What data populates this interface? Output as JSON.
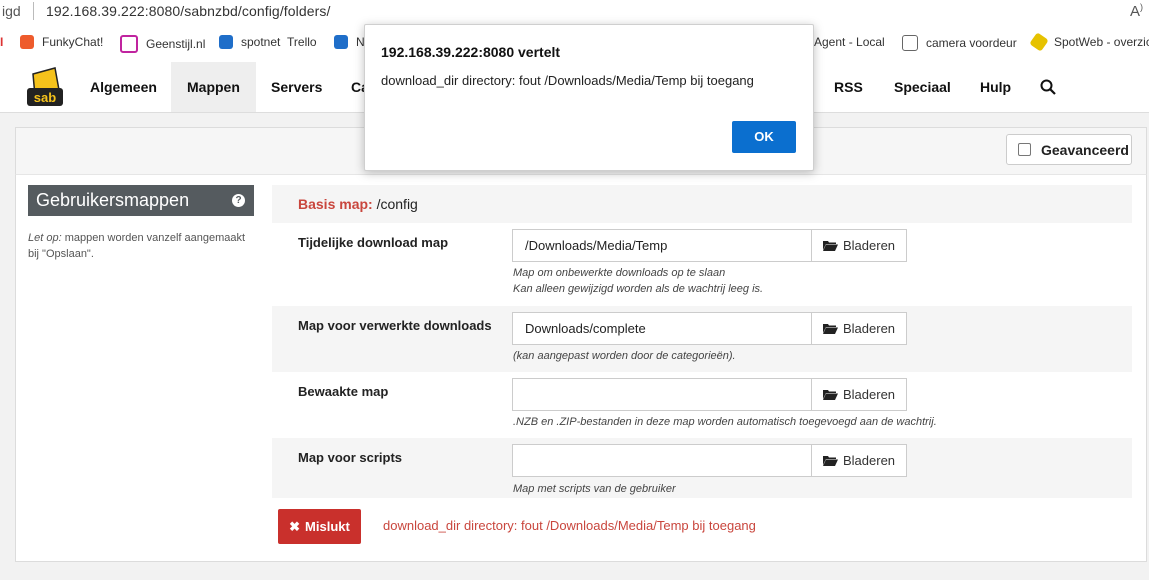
{
  "browser": {
    "left_fragment": "igd",
    "url": "192.168.39.222:8080/sabnzbd/config/folders/",
    "reader_icon": "reader-mode-icon"
  },
  "bookmarks": [
    {
      "label": "FunkyChat!",
      "icon": "funkychat-icon"
    },
    {
      "label": "Geenstijl.nl",
      "icon": "geenstijl-icon"
    },
    {
      "label": "spotnet",
      "icon": "trello-icon"
    },
    {
      "label": "Trello",
      "icon": "trello-icon"
    },
    {
      "label": "N",
      "icon": "q-icon"
    },
    {
      "label": "Agent - Local",
      "icon": ""
    },
    {
      "label": "camera voordeur",
      "icon": "document-icon"
    },
    {
      "label": "SpotWeb - overzic",
      "icon": "spotweb-icon"
    }
  ],
  "nav": {
    "items": [
      "Algemeen",
      "Mappen",
      "Servers",
      "Ca",
      "RSS",
      "Speciaal",
      "Hulp"
    ],
    "active": "Mappen"
  },
  "advanced": {
    "label": "Geavanceerd",
    "checked": false
  },
  "sidebar": {
    "title": "Gebruikersmappen",
    "note_em": "Let op:",
    "note_rest": " mappen worden vanzelf aangemaakt bij \"Opslaan\"."
  },
  "basis": {
    "label": "Basis map:",
    "value": "/config"
  },
  "fields": [
    {
      "label": "Tijdelijke download map",
      "value": "/Downloads/Media/Temp",
      "hint1": "Map om onbewerkte downloads op te slaan",
      "hint2": "Kan alleen gewijzigd worden als de wachtrij leeg is."
    },
    {
      "label": "Map voor verwerkte downloads",
      "value": "Downloads/complete",
      "hint1": "(kan aangepast worden door de categorieën).",
      "hint2": ""
    },
    {
      "label": "Bewaakte map",
      "value": "",
      "hint1": ".NZB en .ZIP-bestanden in deze map worden automatisch toegevoegd aan de wachtrij.",
      "hint2": ""
    },
    {
      "label": "Map voor scripts",
      "value": "",
      "hint1": "Map met scripts van de gebruiker",
      "hint2": ""
    }
  ],
  "browse_label": "Bladeren",
  "status": {
    "fail_label": "Mislukt",
    "message": "download_dir directory: fout /Downloads/Media/Temp bij toegang"
  },
  "dialog": {
    "title": "192.168.39.222:8080 vertelt",
    "message": "download_dir directory: fout /Downloads/Media/Temp bij toegang",
    "ok": "OK"
  },
  "colors": {
    "accent_red": "#c9463d",
    "button_red": "#c9302c",
    "ok_blue": "#0b6fcf",
    "sidebar_grey": "#555b5f"
  }
}
